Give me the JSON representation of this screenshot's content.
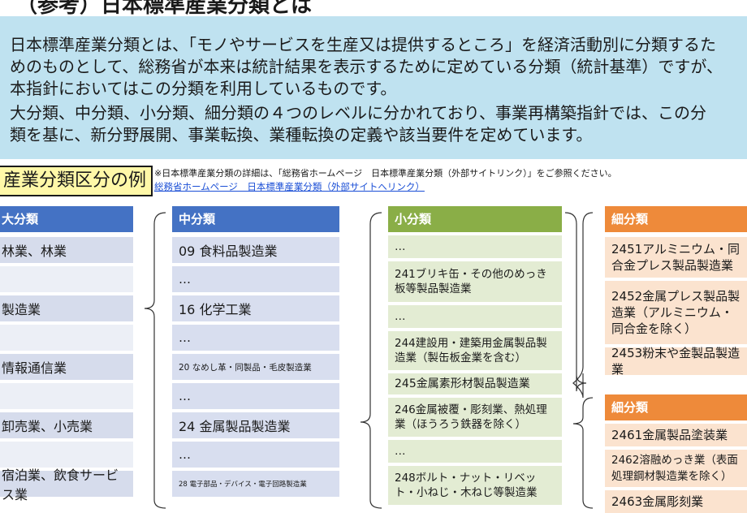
{
  "page": {
    "title": "（参考）日本標準産業分類とは"
  },
  "intro": {
    "p1_line1": "日本標準産業分類とは、「モノやサービスを生産又は提供するところ」を経済活動別に分類するた",
    "p1_line2": "めのものとして、総務省が本来は統計結果を表示するために定めている分類（統計基準）ですが、",
    "p1_line3": "本指針においてはこの分類を利用しているものです。",
    "p2_line1": "大分類、中分類、小分類、細分類の４つのレベルに分かれており、事業再構築指針では、この分",
    "p2_line2": "類を基に、新分野展開、事業転換、業種転換の定義や該当要件を定めています。"
  },
  "example": {
    "label": "産業分類区分の例",
    "note": "※日本標準産業分類の詳細は、「総務省ホームページ　日本標準産業分類（外部サイトリンク）」をご参照ください。",
    "link": "総務省ホームページ　日本標準産業分類（外部サイトへリンク）"
  },
  "daibunrui": {
    "header": "大分類",
    "rows": [
      "林業、林業",
      "",
      "製造業",
      "",
      "情報通信業",
      "",
      "卸売業、小売業",
      "",
      "宿泊業、飲食サービス業"
    ]
  },
  "chubunrui": {
    "header": "中分類",
    "rows": [
      "09 食料品製造業",
      "…",
      "16 化学工業",
      "…",
      "20 なめし革・同製品・毛皮製造業",
      "…",
      "24 金属製品製造業",
      "…",
      "28 電子部品・デバイス・電子回路製造業"
    ]
  },
  "shobunrui": {
    "header": "小分類",
    "rows": [
      "…",
      "241ブリキ缶・その他のめっき板等製品製造業",
      "…",
      "244建設用・建築用金属製品製造業（製缶板金業を含む）",
      "245金属素形材製品製造業",
      "246金属被覆・彫刻業、熱処理業（ほうろう鉄器を除く）",
      "…",
      "248ボルト・ナット・リベット・小ねじ・木ねじ等製造業"
    ]
  },
  "saibunrui": {
    "header1": "細分類",
    "group1": [
      "2451アルミニウム・同合金プレス製品製造業",
      "2452金属プレス製品製造業（アルミニウム・同合金を除く）",
      "2453粉末や金製品製造業"
    ],
    "header2": "細分類",
    "group2": [
      "2461金属製品塗装業",
      "2462溶融めっき業（表面処理鋼材製造業を除く）",
      "2463金属彫刻業"
    ]
  }
}
